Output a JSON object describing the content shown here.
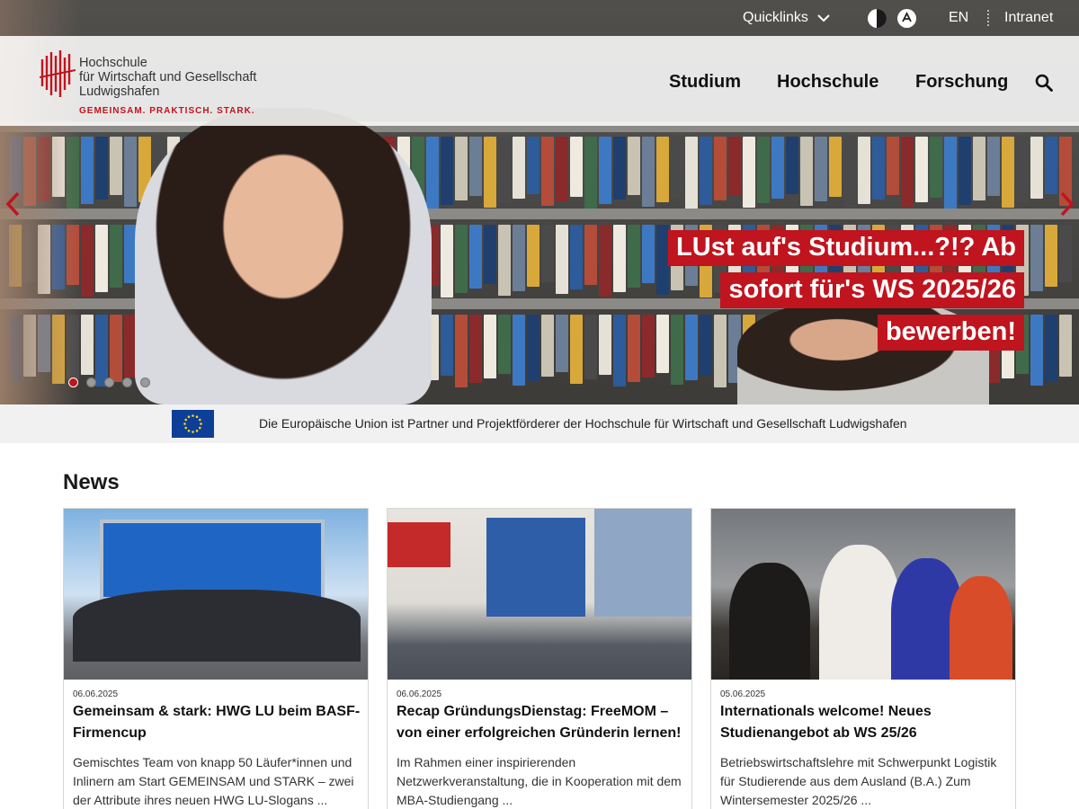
{
  "topbar": {
    "quicklinks_label": "Quicklinks",
    "language_label": "EN",
    "intranet_label": "Intranet"
  },
  "logo": {
    "line1": "Hochschule",
    "line2": "für Wirtschaft und Gesellschaft",
    "line3": "Ludwigshafen",
    "slogan": "GEMEINSAM. PRAKTISCH. STARK."
  },
  "nav": {
    "items": [
      "Studium",
      "Hochschule",
      "Forschung"
    ]
  },
  "hero": {
    "slide_lines": [
      "LUst auf's Studium...?!? Ab",
      "sofort für's WS 2025/26",
      "bewerben!"
    ],
    "slide_count": 5,
    "active_slide": 1
  },
  "eu_notice": {
    "text": "Die Europäische Union ist Partner und Projektförderer der Hochschule für Wirtschaft und Gesellschaft Ludwigshafen"
  },
  "news": {
    "heading": "News",
    "cards": [
      {
        "date": "06.06.2025",
        "title": "Gemeinsam & stark: HWG LU beim BASF-Firmencup",
        "text": "Gemischtes Team von knapp 50 Läufer*innen und Inlinern am Start GEMEINSAM und STARK – zwei der Attribute ihres neuen HWG LU-Slogans ..."
      },
      {
        "date": "06.06.2025",
        "title": "Recap GründungsDienstag: FreeMOM – von einer erfolgreichen Gründerin lernen!",
        "text": "Im Rahmen einer inspirierenden Netzwerkveranstaltung, die in Kooperation mit dem MBA-Studiengang ..."
      },
      {
        "date": "05.06.2025",
        "title": "Internationals welcome! Neues Studienangebot ab WS 25/26",
        "text": "Betriebswirtschaftslehre mit Schwerpunkt Logistik für Studierende aus dem Ausland (B.A.) Zum Wintersemester 2025/26 ..."
      }
    ]
  },
  "colors": {
    "brand_red": "#c0141e",
    "eu_blue": "#0e3f98"
  }
}
